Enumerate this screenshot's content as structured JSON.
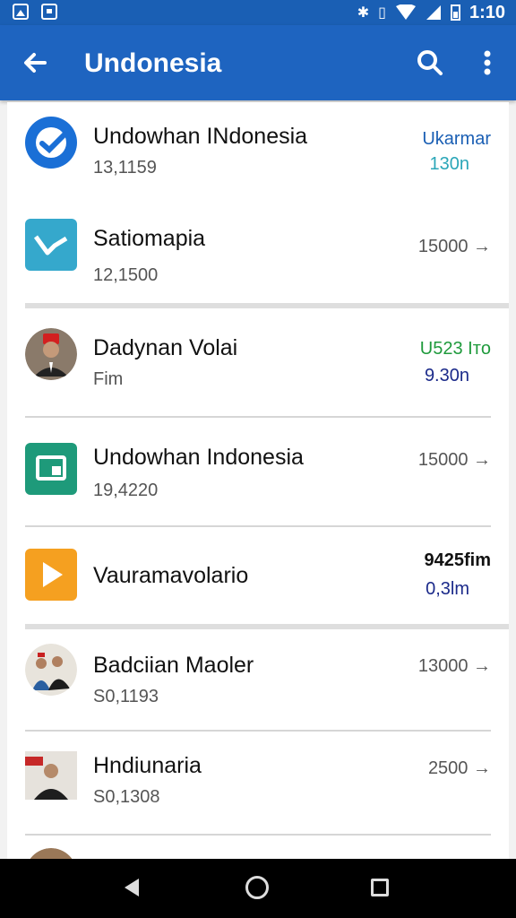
{
  "status_bar": {
    "time": "1:10",
    "icons": [
      "image-icon",
      "shopping-bag-icon",
      "bluetooth-icon",
      "vibrate-icon",
      "wifi-icon",
      "signal-icon",
      "battery-icon"
    ]
  },
  "app_bar": {
    "title": "Undonesia",
    "icons": [
      "back-arrow-icon",
      "search-icon",
      "more-vert-icon"
    ]
  },
  "colors": {
    "app_bar": "#1e64c0",
    "status_bar": "#1a5fb4",
    "accent_blue": "#1a5fb4",
    "accent_green": "#1f9a3c",
    "accent_teal": "#2aa6b8",
    "navy": "#1b2a8a"
  },
  "list": [
    {
      "title": "Undowhan INdonesia",
      "subtitle": "13,1159",
      "value": "Ukarmar",
      "value2": "130n",
      "icon": "check-circle-icon"
    },
    {
      "title": "Satiomapia",
      "subtitle": "12,1500",
      "value": "15000 →",
      "icon": "envelope-icon"
    },
    {
      "title": "Dadynan Volai",
      "subtitle": "Fim",
      "value": "U523 Iтo",
      "value2": "9.30n",
      "icon": "person-avatar"
    },
    {
      "title": "Undowhan Indonesia",
      "subtitle": "19,4220",
      "value": "15000 →",
      "icon": "screen-share-icon"
    },
    {
      "title": "Vauramavolario",
      "subtitle": "",
      "value": "9425fim",
      "value2": "0,3lm",
      "icon": "play-icon"
    },
    {
      "title": "Badciian Maoler",
      "subtitle": "S0,1193",
      "value": "13000 →",
      "icon": "group-photo-avatar"
    },
    {
      "title": "Hndiunaria",
      "subtitle": "S0,1308",
      "value": "2500 →",
      "icon": "person-photo-avatar"
    }
  ],
  "nav_bar": {
    "icons": [
      "nav-back-icon",
      "nav-home-icon",
      "nav-recents-icon"
    ]
  }
}
